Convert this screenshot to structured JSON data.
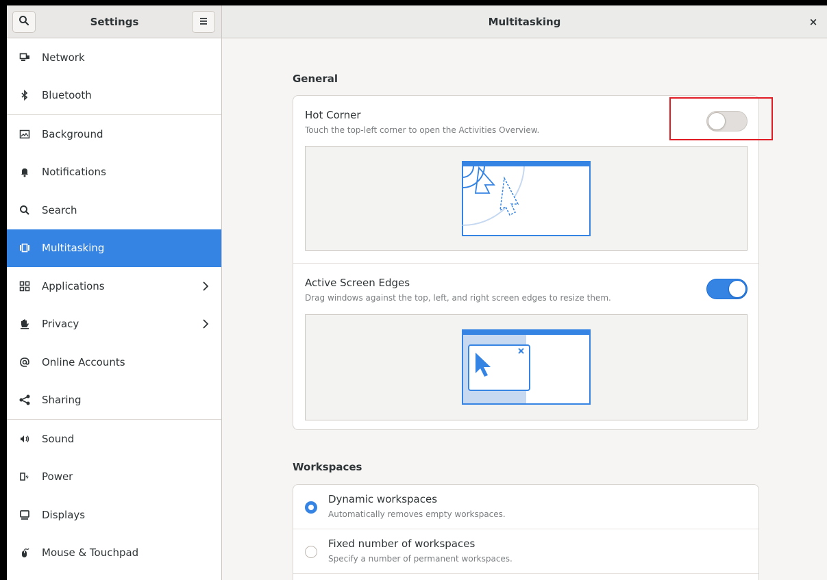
{
  "header": {
    "sidebar_title": "Settings",
    "page_title": "Multitasking",
    "close_glyph": "×"
  },
  "sidebar": {
    "items": [
      {
        "label": "Network",
        "icon": "network-icon"
      },
      {
        "label": "Bluetooth",
        "icon": "bluetooth-icon"
      },
      {
        "label": "Background",
        "icon": "background-icon"
      },
      {
        "label": "Notifications",
        "icon": "bell-icon"
      },
      {
        "label": "Search",
        "icon": "search-icon"
      },
      {
        "label": "Multitasking",
        "icon": "multitasking-icon",
        "active": true
      },
      {
        "label": "Applications",
        "icon": "applications-icon",
        "has_arrow": true
      },
      {
        "label": "Privacy",
        "icon": "hand-icon",
        "has_arrow": true
      },
      {
        "label": "Online Accounts",
        "icon": "at-icon"
      },
      {
        "label": "Sharing",
        "icon": "share-icon"
      },
      {
        "label": "Sound",
        "icon": "speaker-icon"
      },
      {
        "label": "Power",
        "icon": "power-icon"
      },
      {
        "label": "Displays",
        "icon": "display-icon"
      },
      {
        "label": "Mouse & Touchpad",
        "icon": "mouse-icon"
      }
    ]
  },
  "general": {
    "heading": "General",
    "hot_corner": {
      "title": "Hot Corner",
      "subtitle": "Touch the top-left corner to open the Activities Overview.",
      "enabled": false
    },
    "active_edges": {
      "title": "Active Screen Edges",
      "subtitle": "Drag windows against the top, left, and right screen edges to resize them.",
      "enabled": true
    }
  },
  "workspaces": {
    "heading": "Workspaces",
    "dynamic": {
      "title": "Dynamic workspaces",
      "subtitle": "Automatically removes empty workspaces.",
      "selected": true
    },
    "fixed": {
      "title": "Fixed number of workspaces",
      "subtitle": "Specify a number of permanent workspaces.",
      "selected": false
    }
  },
  "colors": {
    "accent": "#3584e4",
    "highlight": "#e01b24"
  }
}
